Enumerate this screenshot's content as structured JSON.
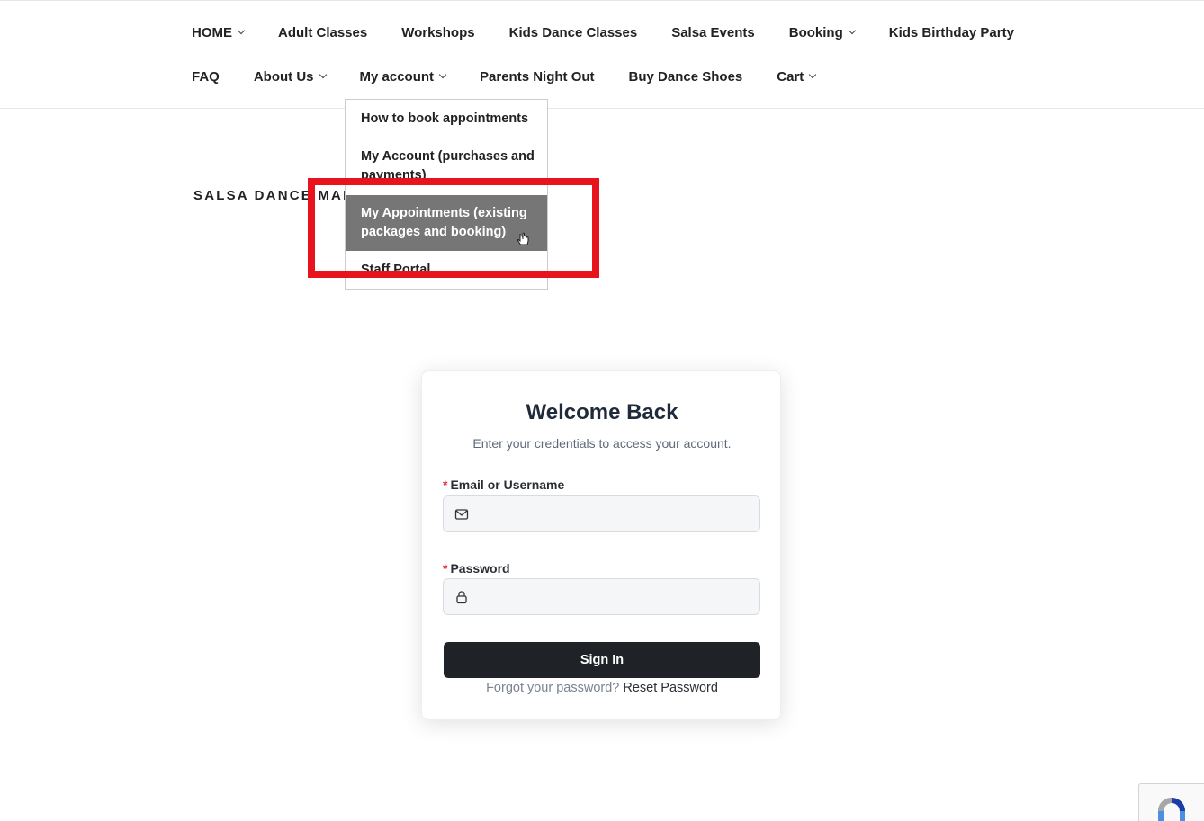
{
  "nav": {
    "row1": [
      {
        "label": "HOME",
        "has_dropdown": true
      },
      {
        "label": "Adult Classes",
        "has_dropdown": false
      },
      {
        "label": "Workshops",
        "has_dropdown": false
      },
      {
        "label": "Kids Dance Classes",
        "has_dropdown": false
      },
      {
        "label": "Salsa Events",
        "has_dropdown": false
      },
      {
        "label": "Booking",
        "has_dropdown": true
      },
      {
        "label": "Kids Birthday Party",
        "has_dropdown": false
      }
    ],
    "row2": [
      {
        "label": "FAQ",
        "has_dropdown": false
      },
      {
        "label": "About Us",
        "has_dropdown": true
      },
      {
        "label": "My account",
        "has_dropdown": true
      },
      {
        "label": "Parents Night Out",
        "has_dropdown": false
      },
      {
        "label": "Buy Dance Shoes",
        "has_dropdown": false
      },
      {
        "label": "Cart",
        "has_dropdown": true
      }
    ]
  },
  "dropdown": {
    "items": [
      {
        "label": "How to book appointments"
      },
      {
        "label": "My Account (purchases and payments)"
      },
      {
        "label": "My Appointments (existing packages and booking)",
        "hovered": true
      },
      {
        "label": "Staff Portal"
      }
    ]
  },
  "site": {
    "title": "SALSA DANCE MARKHAM"
  },
  "login": {
    "title": "Welcome Back",
    "subtitle": "Enter your credentials to access your account.",
    "required_mark": "*",
    "email_label": "Email or Username",
    "email_value": "",
    "password_label": "Password",
    "password_value": "",
    "submit_label": "Sign In",
    "forgot_text": "Forgot your password?",
    "reset_link": "Reset Password"
  },
  "colors": {
    "highlight": "#e8131d",
    "hover_bg": "#767676",
    "button_bg": "#1f2226"
  },
  "icons": {
    "email": "mail-icon",
    "password": "lock-icon",
    "recaptcha": "recaptcha-icon",
    "cursor": "hand-pointer-icon"
  }
}
